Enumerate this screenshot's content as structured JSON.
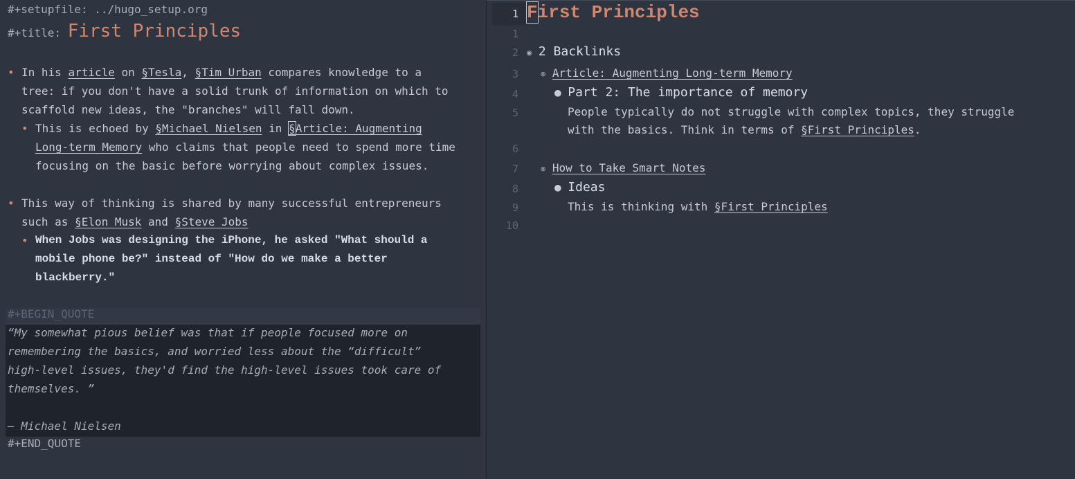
{
  "left": {
    "setupfile": "#+setupfile: ../hugo_setup.org",
    "title_key": "#+title:",
    "title_value": "First Principles",
    "bullet_glyph": "•",
    "p1": {
      "l1_a": "In his ",
      "l1_link1": "article",
      "l1_b": " on ",
      "l1_link2": "§Tesla",
      "l1_c": ", ",
      "l1_link3": "§Tim Urban",
      "l1_d": " compares knowledge to a",
      "l2": "tree: if you don't have a solid trunk of information on which to",
      "l3": "scaffold new ideas, the \"branches\" will fall down."
    },
    "p1_sub": {
      "l1_a": "This is echoed by ",
      "l1_link1": "§Michael Nielsen",
      "l1_b": " in ",
      "l1_link2_cursor": "§",
      "l1_link2": "Article: Augmenting ",
      "l2_link": "Long-term Memory",
      "l2_b": " who claims that people need to spend more time",
      "l3": "focusing on the basic before worrying about complex issues."
    },
    "p2": {
      "l1": "This way of thinking is shared by many successful entrepreneurs",
      "l2_a": "such as ",
      "l2_link1": "§Elon Musk",
      "l2_b": " and ",
      "l2_link2": "§Steve Jobs"
    },
    "p2_sub": {
      "l1": "When Jobs was designing the iPhone, he asked \"What should a",
      "l2": "mobile phone be?\" instead of \"How do we make a better",
      "l3": "blackberry.\""
    },
    "begin_quote": "#+BEGIN_QUOTE",
    "quote": {
      "l1": "“My somewhat pious belief was that if people focused more on",
      "l2": "remembering the basics, and worried less about the “difficult”",
      "l3": "high-level issues, they'd find the high-level issues took care of",
      "l4": "themselves. ”",
      "attribution": "— Michael Nielsen"
    },
    "end_quote": "#+END_QUOTE"
  },
  "right": {
    "line_numbers": [
      "1",
      "1",
      "2",
      "3",
      "4",
      "5",
      "6",
      "7",
      "8",
      "9",
      "10"
    ],
    "title": "First Principles",
    "title_first_char": "F",
    "backlinks_glyph": "◉",
    "backlinks_label": "2 Backlinks",
    "sub_glyph": "⊚",
    "dot_glyph": "●",
    "entry1": {
      "link": "Article: Augmenting Long-term Memory",
      "heading": "Part 2: The importance of memory",
      "text_l1": "People typically do not struggle with complex topics, they struggle",
      "text_l2_a": "with the basics. Think in terms of ",
      "text_l2_link": "§First Principles",
      "text_l2_b": "."
    },
    "entry2": {
      "link": "How to Take Smart Notes",
      "heading": "Ideas",
      "text_a": "This is thinking with ",
      "text_link": "§First Principles"
    }
  }
}
